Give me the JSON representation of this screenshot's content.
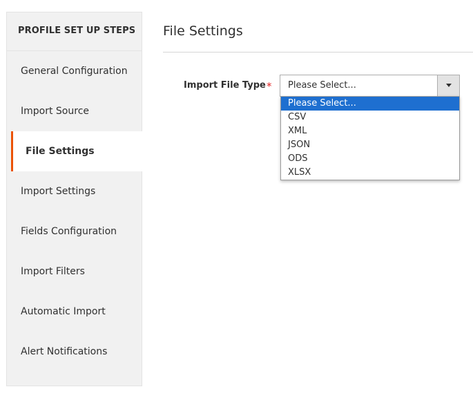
{
  "sidebar": {
    "title": "PROFILE SET UP STEPS",
    "items": [
      {
        "label": "General Configuration"
      },
      {
        "label": "Import Source"
      },
      {
        "label": "File Settings"
      },
      {
        "label": "Import Settings"
      },
      {
        "label": "Fields Configuration"
      },
      {
        "label": "Import Filters"
      },
      {
        "label": "Automatic Import"
      },
      {
        "label": "Alert Notifications"
      }
    ],
    "active_index": 2
  },
  "main": {
    "title": "File Settings",
    "field": {
      "label": "Import File Type",
      "required_mark": "*",
      "selected_value": "Please Select...",
      "options": [
        "Please Select...",
        "CSV",
        "XML",
        "JSON",
        "ODS",
        "XLSX"
      ]
    }
  },
  "colors": {
    "active_accent": "#eb5202",
    "required": "#e22626",
    "option_highlight": "#1e6fd0"
  },
  "icons": {
    "select_arrow": "caret-down-icon"
  }
}
